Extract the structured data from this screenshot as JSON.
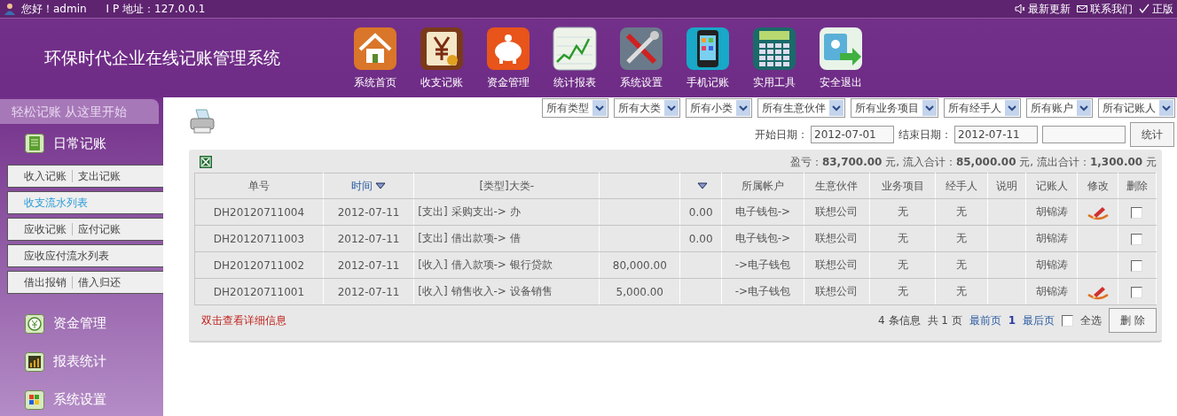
{
  "top_bar": {
    "greeting": "您好！admin",
    "ip": "I P 地址：127.0.0.1",
    "links": [
      {
        "label": "最新更新",
        "kind": "speaker"
      },
      {
        "label": "联系我们",
        "kind": "mail"
      },
      {
        "label": "正版",
        "kind": "check"
      }
    ]
  },
  "header": {
    "title": "环保时代企业在线记账管理系统",
    "nav": [
      {
        "label": "系统首页"
      },
      {
        "label": "收支记账"
      },
      {
        "label": "资金管理"
      },
      {
        "label": "统计报表"
      },
      {
        "label": "系统设置"
      },
      {
        "label": "手机记账"
      },
      {
        "label": "实用工具"
      },
      {
        "label": "安全退出"
      }
    ]
  },
  "sidebar": {
    "tagline": "轻松记账 从这里开始",
    "sections": [
      {
        "label": "日常记账",
        "expanded": true,
        "rows": [
          {
            "links": [
              {
                "label": "收入记账",
                "selected": false
              },
              {
                "label": "支出记账",
                "selected": false
              }
            ]
          },
          {
            "links": [
              {
                "label": "收支流水列表",
                "selected": true
              }
            ]
          },
          {
            "links": [
              {
                "label": "应收记账",
                "selected": false
              },
              {
                "label": "应付记账",
                "selected": false
              }
            ]
          },
          {
            "links": [
              {
                "label": "应收应付流水列表",
                "selected": false
              }
            ]
          },
          {
            "links": [
              {
                "label": "借出报销",
                "selected": false
              },
              {
                "label": "借入归还",
                "selected": false
              }
            ]
          }
        ]
      },
      {
        "label": "资金管理",
        "expanded": false
      },
      {
        "label": "报表统计",
        "expanded": false
      },
      {
        "label": "系统设置",
        "expanded": false
      }
    ]
  },
  "filters": [
    "所有类型",
    "所有大类",
    "所有小类",
    "所有生意伙伴",
    "所有业务项目",
    "所有经手人",
    "所有账户",
    "所有记账人"
  ],
  "date_range": {
    "start_label": "开始日期：",
    "start": "2012-07-01",
    "end_label": "结束日期：",
    "end": "2012-07-11",
    "submit": "统计"
  },
  "summary": "盈亏：**83,700.00** 元, 流入合计：**85,000.00** 元, 流出合计：**1,300.00** 元",
  "table": {
    "columns": [
      {
        "label": "单号",
        "sorted": false
      },
      {
        "label": "时间",
        "sorted": true
      },
      {
        "label": "[类型]大类-",
        "sorted": false
      },
      {
        "sorted": false
      },
      {
        "sorted": true
      },
      {
        "label": "所属帐户",
        "sorted": false
      },
      {
        "label": "生意伙伴",
        "sorted": false
      },
      {
        "label": "业务项目",
        "sorted": false
      },
      {
        "label": "经手人",
        "sorted": false
      },
      {
        "label": "说明",
        "sorted": false
      },
      {
        "label": "记账人",
        "sorted": false
      },
      {
        "label": "修改",
        "sorted": false
      },
      {
        "label": "删除",
        "sorted": false
      }
    ],
    "rows": [
      {
        "number": "DH20120711004",
        "time": "2012-07-11",
        "category": "[支出] 采购支出-> 办",
        "outflow": "0.00",
        "account": "电子钱包->",
        "partner": "联想公司",
        "project": "无",
        "handler": "无",
        "bookkeeper": "胡锦涛",
        "editable": true,
        "checked": false
      },
      {
        "number": "DH20120711003",
        "time": "2012-07-11",
        "category": "[支出] 借出款项-> 借",
        "outflow": "0.00",
        "account": "电子钱包->",
        "partner": "联想公司",
        "project": "无",
        "handler": "无",
        "bookkeeper": "胡锦涛",
        "editable": false,
        "checked": false
      },
      {
        "number": "DH20120711002",
        "time": "2012-07-11",
        "category": "[收入] 借入款项-> 银行贷款",
        "inflow": "80,000.00",
        "account": "->电子钱包",
        "partner": "联想公司",
        "project": "无",
        "handler": "无",
        "bookkeeper": "胡锦涛",
        "editable": false,
        "checked": false
      },
      {
        "number": "DH20120711001",
        "time": "2012-07-11",
        "category": "[收入] 销售收入-> 设备销售",
        "inflow": "5,000.00",
        "account": "->电子钱包",
        "partner": "联想公司",
        "project": "无",
        "handler": "无",
        "bookkeeper": "胡锦涛",
        "editable": true,
        "checked": false
      }
    ]
  },
  "footer": {
    "hint": "双击查看详细信息",
    "count": "4 条信息",
    "pages": "共 1 页",
    "first": "最前页",
    "current": "1",
    "last": "最后页",
    "select_all": {
      "label": "全选",
      "checked": false
    },
    "delete": "删 除"
  }
}
